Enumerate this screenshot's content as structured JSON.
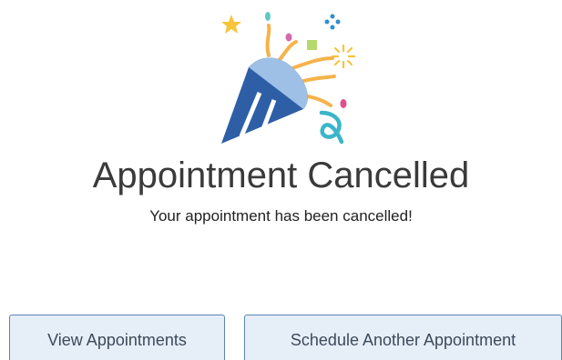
{
  "confirmation": {
    "title": "Appointment Cancelled",
    "message": "Your appointment has been cancelled!",
    "illustration_icon": "party-popper-icon"
  },
  "actions": {
    "view_label": "View Appointments",
    "schedule_label": "Schedule Another Appointment"
  },
  "colors": {
    "button_bg": "#e6eef8",
    "button_border": "#5b84b8",
    "popper_blue": "#2e5fa6",
    "streamer_orange": "#f6b24a",
    "star_yellow": "#f7c43a",
    "teal": "#3bb6c8",
    "pink": "#e0508a"
  }
}
